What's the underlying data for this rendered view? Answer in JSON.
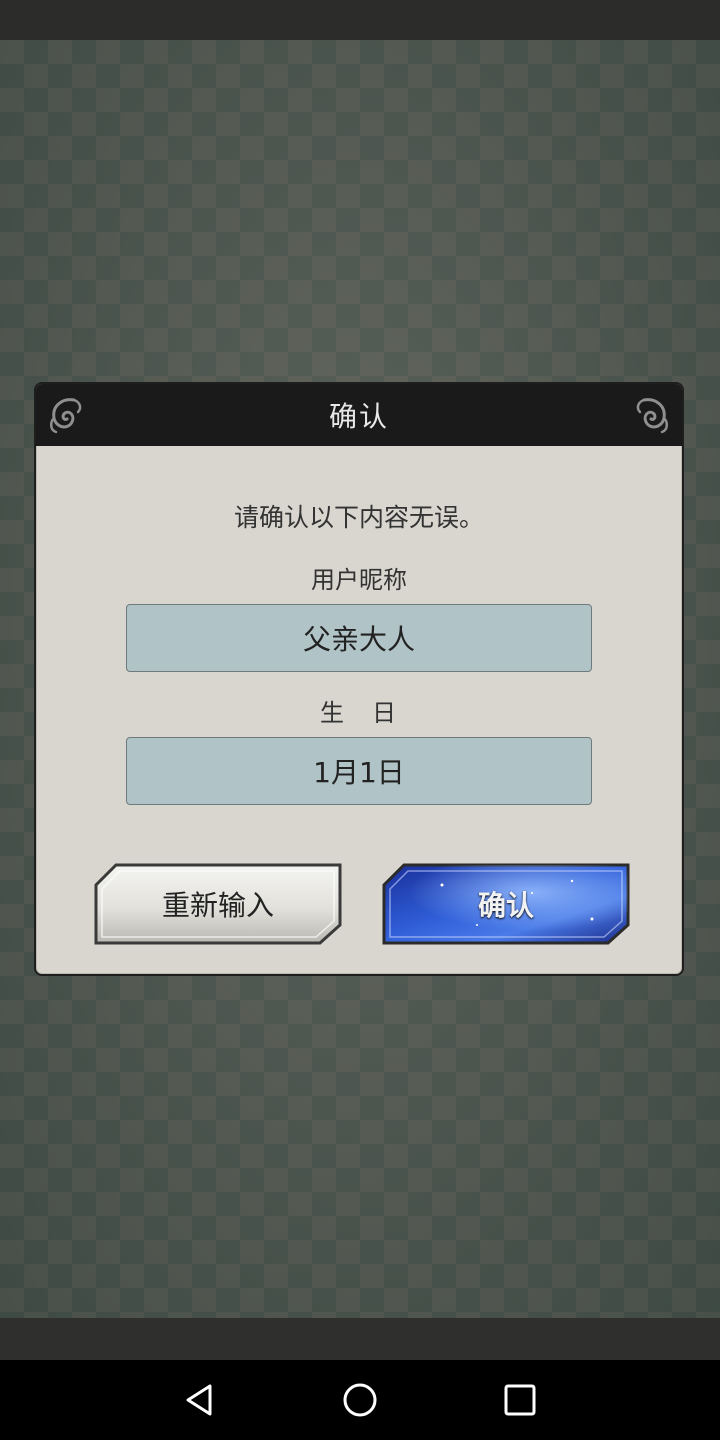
{
  "dialog": {
    "title": "确认",
    "prompt": "请确认以下内容无误。",
    "nickname_label": "用户昵称",
    "nickname_value": "父亲大人",
    "birthday_label": "生　日",
    "birthday_value": "1月1日",
    "reset_button_label": "重新输入",
    "confirm_button_label": "确认"
  },
  "colors": {
    "dialog_bg": "#d9d6cf",
    "header_bg": "#1a1a1a",
    "field_bg": "#b0c3c6",
    "confirm_button": "#1e3fb5"
  },
  "navigation": {
    "icons": [
      "back-icon",
      "home-icon",
      "recent-apps-icon"
    ]
  }
}
